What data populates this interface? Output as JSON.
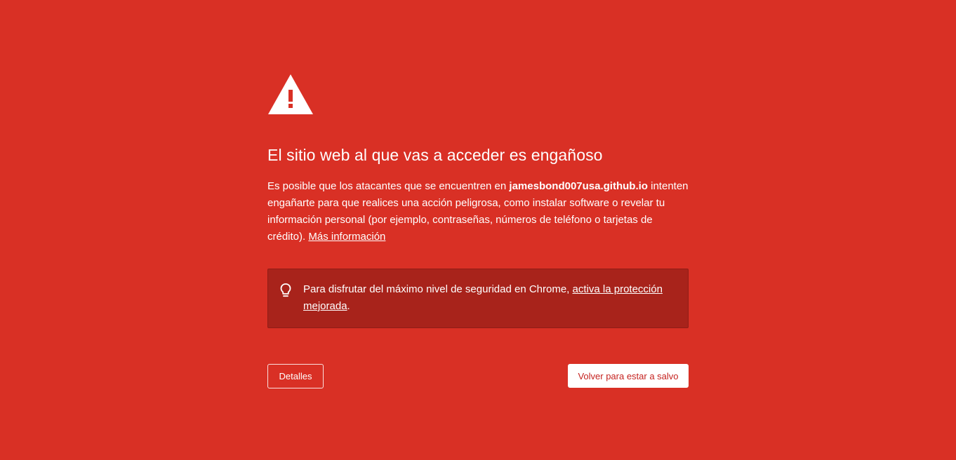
{
  "colors": {
    "background": "#d93025",
    "tip_background": "#a8231b",
    "primary_button_text": "#c5221f",
    "text": "#ffffff"
  },
  "header": {
    "icon": "warning-triangle-icon",
    "title": "El sitio web al que vas a acceder es engañoso"
  },
  "message": {
    "part1": "Es posible que los atacantes que se encuentren en ",
    "host": "jamesbond007usa.github.io",
    "part2": " intenten engañarte para que realices una acción peligrosa, como instalar software o revelar tu información personal (por ejemplo, contraseñas, números de teléfono o tarjetas de crédito). ",
    "learn_more": "Más información"
  },
  "tip": {
    "icon": "lightbulb-icon",
    "text": "Para disfrutar del máximo nivel de seguridad en Chrome, ",
    "link": "activa la protección mejorada",
    "end": "."
  },
  "buttons": {
    "details": "Detalles",
    "back_to_safety": "Volver para estar a salvo"
  }
}
